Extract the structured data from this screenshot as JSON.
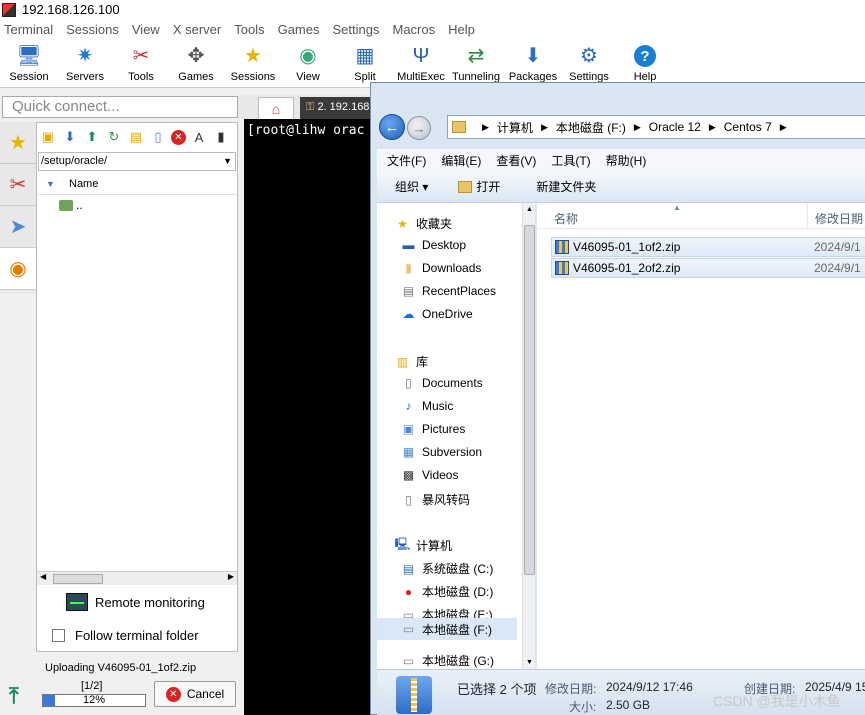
{
  "window": {
    "title": "192.168.126.100"
  },
  "menu": [
    "Terminal",
    "Sessions",
    "View",
    "X server",
    "Tools",
    "Games",
    "Settings",
    "Macros",
    "Help"
  ],
  "toolbar": {
    "session": "Session",
    "servers": "Servers",
    "tools": "Tools",
    "games": "Games",
    "sessions": "Sessions",
    "view": "View",
    "split": "Split",
    "multiexec": "MultiExec",
    "tunneling": "Tunneling",
    "packages": "Packages",
    "settings": "Settings",
    "help": "Help"
  },
  "quick_connect": {
    "placeholder": "Quick connect..."
  },
  "sftp": {
    "path": "/setup/oracle/",
    "column_name": "Name",
    "parent_entry": "..",
    "remote_monitoring": "Remote monitoring",
    "follow_terminal": "Follow terminal folder",
    "upload": {
      "text": "Uploading V46095-01_1of2.zip",
      "count": "[1/2]",
      "percent": 12,
      "percent_label": "12%",
      "cancel": "Cancel"
    }
  },
  "terminal": {
    "tab": "2. 192.168",
    "prompt": "[root@lihw orac"
  },
  "explorer": {
    "address": [
      "计算机",
      "本地磁盘 (F:)",
      "Oracle 12",
      "Centos 7"
    ],
    "menu": [
      "文件(F)",
      "编辑(E)",
      "查看(V)",
      "工具(T)",
      "帮助(H)"
    ],
    "cmd": {
      "organize": "组织 ▾",
      "open": "打开",
      "new_folder": "新建文件夹"
    },
    "nav": {
      "favorites": "收藏夹",
      "desktop": "Desktop",
      "downloads": "Downloads",
      "recent": "RecentPlaces",
      "onedrive": "OneDrive",
      "library": "库",
      "documents": "Documents",
      "music": "Music",
      "pictures": "Pictures",
      "subversion": "Subversion",
      "videos": "Videos",
      "storm": "暴风转码",
      "computer": "计算机",
      "drive_c": "系统磁盘 (C:)",
      "drive_d": "本地磁盘 (D:)",
      "drive_e": "本地磁盘 (E:)",
      "drive_f": "本地磁盘 (F:)",
      "drive_g": "本地磁盘 (G:)"
    },
    "columns": {
      "name": "名称",
      "modified": "修改日期"
    },
    "files": [
      {
        "name": "V46095-01_1of2.zip",
        "date": "2024/9/1"
      },
      {
        "name": "V46095-01_2of2.zip",
        "date": "2024/9/1"
      }
    ],
    "details": {
      "selected": "已选择 2 个项",
      "modified_label": "修改日期:",
      "modified_value": "2024/9/12 17:46",
      "created_label": "创建日期:",
      "created_value": "2025/4/9 15:",
      "size_label": "大小:",
      "size_value": "2.50 GB"
    }
  },
  "watermark": "CSDN @我是小木鱼"
}
